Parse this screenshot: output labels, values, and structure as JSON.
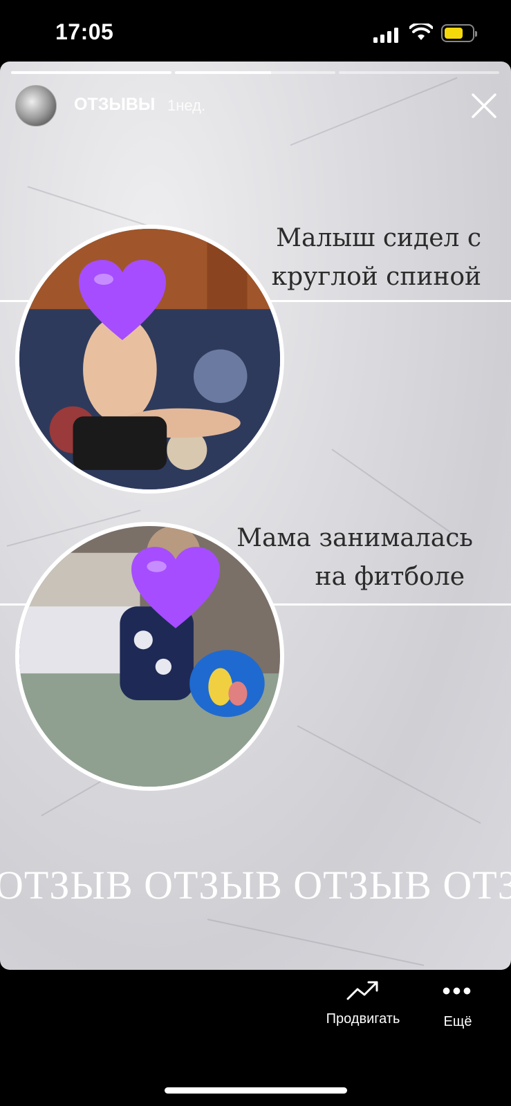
{
  "status_bar": {
    "time": "17:05"
  },
  "story": {
    "username": "ОТЗЫВЫ",
    "posted_ago": "1нед.",
    "progress": [
      {
        "fraction": 1.0
      },
      {
        "fraction": 0.6
      },
      {
        "fraction": 0.0
      }
    ],
    "captions": [
      {
        "line1": "Малыш сидел с",
        "line2": "круглой спиной"
      },
      {
        "line1": "Мама занималась",
        "line2": "на фитболе"
      }
    ],
    "watermark": "ОТЗЫВ ОТЗЫВ ОТЗЫВ ОТЗЫВ",
    "heart_color": "#a64dff"
  },
  "actions": {
    "promote_label": "Продвигать",
    "more_label": "Ещё"
  }
}
